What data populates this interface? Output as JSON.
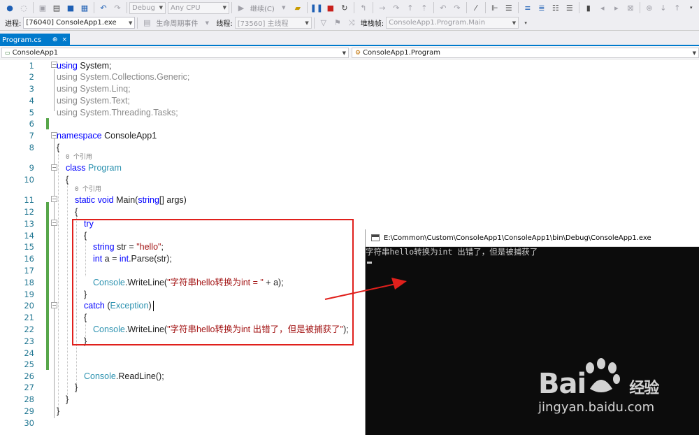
{
  "toolbar": {
    "config_value": "Debug",
    "platform_value": "Any CPU",
    "continue_label": "继续(C)",
    "process_label": "进程:",
    "process_value": "[76040] ConsoleApp1.exe",
    "lifecycle_label": "生命周期事件",
    "thread_label": "线程:",
    "thread_value": "[73560] 主线程",
    "stackframe_label": "堆栈帧:",
    "stackframe_value": "ConsoleApp1.Program.Main"
  },
  "tab": {
    "label": "Program.cs",
    "pin": "⊕",
    "close": "×"
  },
  "navbar": {
    "project": "ConsoleApp1",
    "class": "ConsoleApp1.Program"
  },
  "editor": {
    "line_numbers": [
      "1",
      "2",
      "3",
      "4",
      "5",
      "6",
      "7",
      "8",
      "9",
      "10",
      "11",
      "12",
      "13",
      "14",
      "15",
      "16",
      "17",
      "18",
      "19",
      "20",
      "21",
      "22",
      "23",
      "24",
      "25",
      "26",
      "27",
      "28",
      "29",
      "30"
    ],
    "ref_hint": "0 个引用",
    "lines": {
      "l1_kw": "using",
      "l1_rest": " System;",
      "l2": "using System.Collections.Generic;",
      "l3": "using System.Linq;",
      "l4": "using System.Text;",
      "l5": "using System.Threading.Tasks;",
      "l7_kw": "namespace",
      "l7_rest": " ConsoleApp1",
      "l8": "{",
      "l9_kw": "class",
      "l9_type": "Program",
      "l10": "{",
      "l11_kw1": "static",
      "l11_kw2": "void",
      "l11_rest1": " Main(",
      "l11_kw3": "string",
      "l11_rest2": "[] args)",
      "l12": "{",
      "l13_kw": "try",
      "l14": "{",
      "l15_kw": "string",
      "l15_rest": " str = ",
      "l15_str": "\"hello\"",
      "l15_end": ";",
      "l16_kw": "int",
      "l16_rest1": " a = ",
      "l16_kw2": "int",
      "l16_rest2": ".Parse(str);",
      "l18_type": "Console",
      "l18_rest1": ".WriteLine(",
      "l18_str": "\"字符串hello转换为int = \"",
      "l18_rest2": " + a);",
      "l19": "}",
      "l20_kw": "catch",
      "l20_rest1": " (",
      "l20_type": "Exception",
      "l20_rest2": ")",
      "l21": "{",
      "l22_type": "Console",
      "l22_rest1": ".WriteLine(",
      "l22_str": "\"字符串hello转换为int 出错了，但是被捕获了\"",
      "l22_rest2": ");",
      "l23": "}",
      "l26_type": "Console",
      "l26_rest": ".ReadLine();",
      "l27": "}",
      "l28": "}",
      "l29": "}"
    }
  },
  "console": {
    "title": "E:\\Common\\Custom\\ConsoleApp1\\ConsoleApp1\\bin\\Debug\\ConsoleApp1.exe",
    "output": "字符串hello转换为int 出错了，但是被捕获了"
  },
  "watermark": {
    "brand": "Bai",
    "brand_cn": "经验",
    "url": "jingyan.baidu.com"
  },
  "colors": {
    "keyword": "#0000ff",
    "type": "#2b91af",
    "string": "#a31515",
    "annotation": "#e0201c",
    "tab_active": "#007acc"
  }
}
